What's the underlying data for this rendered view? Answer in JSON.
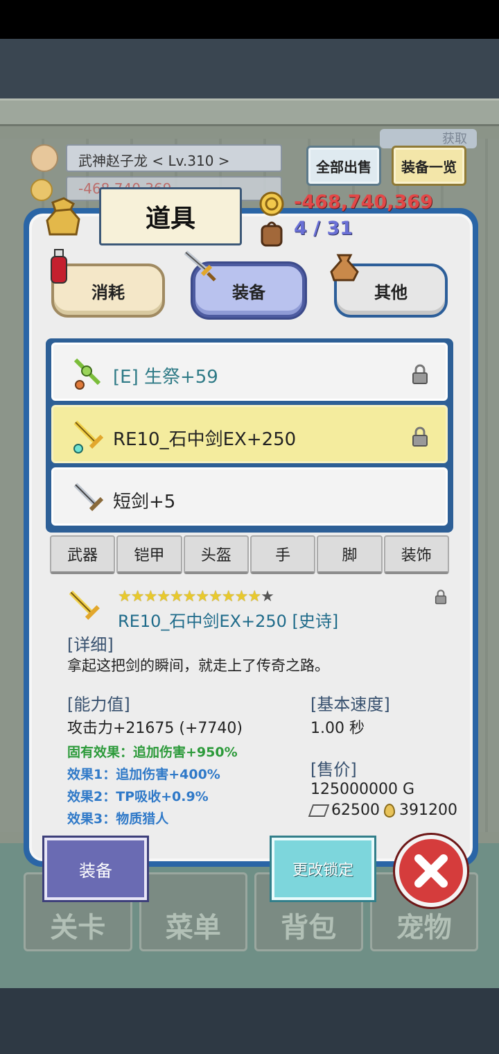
{
  "player": {
    "name_level": "武神赵子龙    < Lv.310 >",
    "gold_bg": "-468,740,369"
  },
  "top_buttons": {
    "sell_all": "全部出售",
    "equip_list": "装备一览",
    "get": "获取"
  },
  "panel": {
    "title": "道具",
    "gold": "-468,740,369",
    "capacity": "4 / 31",
    "categories": [
      {
        "label": "消耗",
        "selected": false
      },
      {
        "label": "装备",
        "selected": true
      },
      {
        "label": "其他",
        "selected": false
      }
    ]
  },
  "items": [
    {
      "name": "[E] 生祭+59",
      "locked": true,
      "selected": false
    },
    {
      "name": "RE10_石中剑EX+250",
      "locked": true,
      "selected": true
    },
    {
      "name": "短剑+5",
      "locked": false,
      "selected": false
    }
  ],
  "filters": [
    "武器",
    "铠甲",
    "头盔",
    "手",
    "脚",
    "装饰"
  ],
  "detail": {
    "stars_filled": 11,
    "stars_total": 12,
    "name": "RE10_石中剑EX+250 [史诗]",
    "detail_header": "[详细]",
    "description": "拿起这把剑的瞬间，就走上了传奇之路。",
    "ability_header": "[能力值]",
    "attack": "攻击力+21675 (+7740)",
    "fixed_effect": "固有效果：追加伤害+950%",
    "effect1": "效果1：追加伤害+400%",
    "effect2": "效果2：TP吸收+0.9%",
    "effect3": "效果3：物质猎人",
    "speed_header": "[基本速度]",
    "speed": "1.00 秒",
    "price_header": "[售价]",
    "price": "125000000 G",
    "mat1": "62500",
    "mat2": "391200"
  },
  "actions": {
    "equip": "装备",
    "change_lock": "更改锁定"
  },
  "bottom_nav": [
    "关卡",
    "菜单",
    "背包",
    "宠物"
  ],
  "colors": {
    "panel_border": "#2a65a6",
    "gold_text": "#e24848",
    "effect_green": "#2c9a3a",
    "effect_blue": "#2f79c8"
  }
}
